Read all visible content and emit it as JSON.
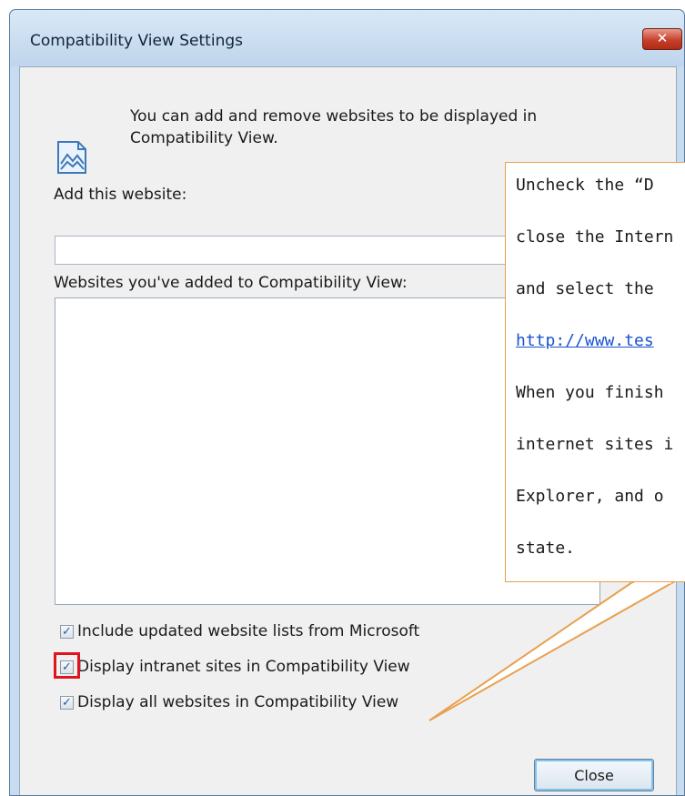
{
  "dialog": {
    "title": "Compatibility View Settings",
    "close_x": "✕",
    "info_text_line1": "You can add and remove websites to be displayed in",
    "info_text_line2": "Compatibility View.",
    "add_label": "Add this website:",
    "add_value": "",
    "list_label": "Websites you've added to Compatibility View:",
    "checkboxes": [
      {
        "label": "Include updated website lists from Microsoft",
        "checked": true
      },
      {
        "label": "Display intranet sites in Compatibility View",
        "checked": true
      },
      {
        "label": "Display all websites in Compatibility View",
        "checked": true
      }
    ],
    "check_glyph": "✓",
    "close_button": "Close"
  },
  "callout": {
    "lines": [
      "Uncheck the “D",
      "close the Intern",
      "and select the",
      "http://www.tes",
      "When you finish",
      "internet sites i",
      "Explorer, and o",
      "state."
    ]
  },
  "colors": {
    "callout_border": "#e8a050",
    "highlight": "#e0141e",
    "link": "#1a52d0"
  }
}
